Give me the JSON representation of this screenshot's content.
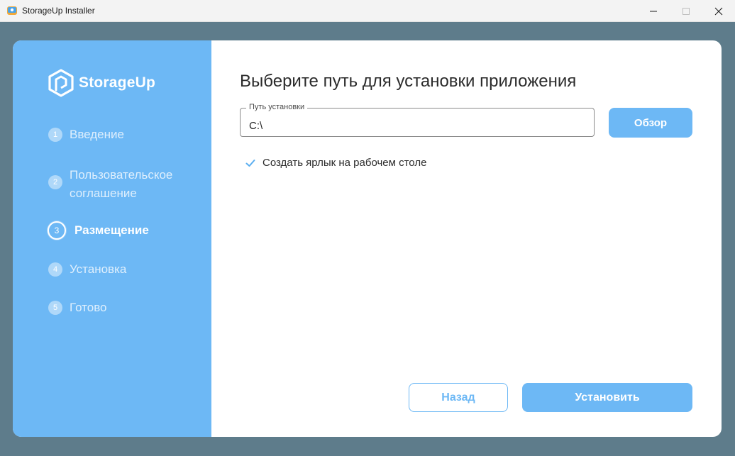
{
  "window": {
    "title": "StorageUp Installer",
    "icons": {
      "app": "storageup-app-icon",
      "minimize": "minimize-icon",
      "maximize": "maximize-icon",
      "close": "close-icon"
    }
  },
  "sidebar": {
    "brand": "StorageUp",
    "brand_icon": "storageup-logo-icon",
    "steps": [
      {
        "num": "1",
        "label": "Введение"
      },
      {
        "num": "2",
        "label": "Пользовательское соглашение"
      },
      {
        "num": "3",
        "label": "Размещение"
      },
      {
        "num": "4",
        "label": "Установка"
      },
      {
        "num": "5",
        "label": "Готово"
      }
    ],
    "active_step": "3"
  },
  "main": {
    "title": "Выберите путь для установки приложения",
    "path_field": {
      "label": "Путь установки",
      "value": "C:\\"
    },
    "browse_label": "Обзор",
    "shortcut": {
      "label": "Создать ярлык на рабочем столе",
      "checked": true,
      "icon": "checkmark-icon"
    },
    "back_label": "Назад",
    "install_label": "Установить"
  },
  "colors": {
    "accent": "#6db8f5",
    "background": "#5e7c8b",
    "titlebar": "#f3f3f3"
  }
}
